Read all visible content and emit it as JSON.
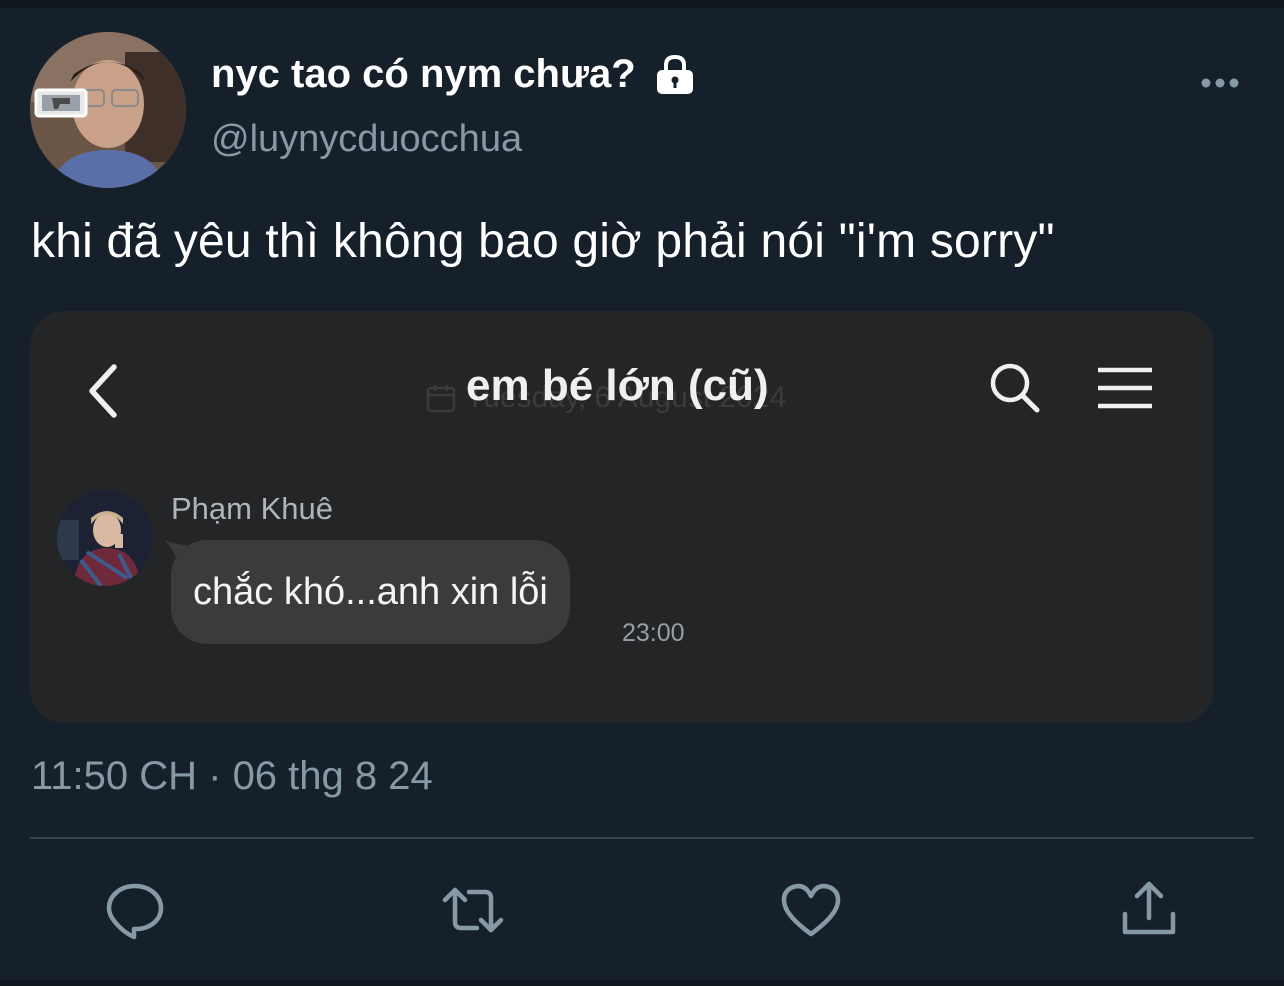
{
  "user": {
    "display_name": "nyc tao có nym chưa?",
    "handle": "@luynycduocchua",
    "protected_icon": "lock-icon"
  },
  "tweet": {
    "text": "khi đã yêu thì không bao giờ phải nói \"i'm sorry\"",
    "timestamp": "11:50 CH · 06 thg 8 24"
  },
  "chat_screenshot": {
    "title": "em bé lớn (cũ)",
    "ghost_date_header": "Tuesday, 6 August 2024",
    "sender_name": "Phạm Khuê",
    "message": "chắc khó...anh xin lỗi",
    "message_time": "23:00",
    "icons": [
      "back-arrow-icon",
      "search-icon",
      "hamburger-menu-icon"
    ]
  },
  "actions": [
    {
      "name": "reply-button",
      "icon": "speech-bubble-icon"
    },
    {
      "name": "retweet-button",
      "icon": "retweet-arrows-icon"
    },
    {
      "name": "like-button",
      "icon": "heart-icon"
    },
    {
      "name": "share-button",
      "icon": "share-upload-icon"
    }
  ],
  "colors": {
    "background": "#15202b",
    "secondary_text": "#8899a6",
    "card_background": "#242526",
    "bubble": "#3a3b3c"
  }
}
